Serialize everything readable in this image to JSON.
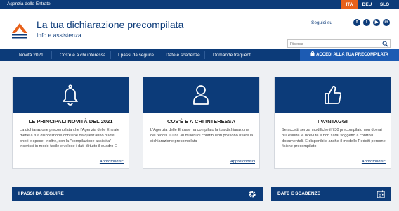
{
  "topbar": {
    "agency": "Agenzia delle Entrate",
    "languages": [
      "ITA",
      "DEU",
      "SLO"
    ],
    "active_language": "ITA"
  },
  "header": {
    "title": "La tua dichiarazione precompilata",
    "subtitle": "Info e assistenza",
    "follow_label": "Seguici su",
    "social": [
      "facebook-icon",
      "twitter-icon",
      "youtube-icon",
      "linkedin-icon"
    ],
    "search_placeholder": "Ricerca"
  },
  "nav": {
    "items": [
      "Novità 2021",
      "Cos'è e a chi interessa",
      "I passi da seguire",
      "Date e scadenze",
      "Domande frequenti"
    ],
    "cta": "ACCEDI ALLA TUA PRECOMPILATA",
    "cta_icon": "lock-icon"
  },
  "cards": [
    {
      "icon": "bell-icon",
      "title": "LE PRINCIPALI NOVITÀ DEL 2021",
      "text": "La dichiarazione precompilata che l'Agenzia delle Entrate mette a tua disposizione contiene da quest'anno nuovi oneri e spese. Inoltre, con la \"compilazione assistita\" inserisci in modo facile e veloce i dati di tutto il quadro E",
      "link": "Approfondisci"
    },
    {
      "icon": "user-icon",
      "title": "COS'È E A CHI INTERESSA",
      "text": "L'Agenzia delle Entrate ha compilato la tua dichiarazione dei redditi. Circa 30 milioni di contribuenti possono usare la dichiarazione precompilata",
      "link": "Approfondisci"
    },
    {
      "icon": "thumbs-up-icon",
      "title": "I VANTAGGI",
      "text": "Se accetti senza modifiche il 730 precompilato non dovrai più esibire le ricevute e non sarai soggetto a controlli documentali. È disponibile anche il modello Redditi persone fisiche precompilato",
      "link": "Approfondisci"
    }
  ],
  "sections": [
    {
      "label": "I PASSI DA SEGUIRE",
      "icon": "gear-icon"
    },
    {
      "label": "DATE E SCADENZE",
      "icon": "calendar-icon"
    }
  ],
  "colors": {
    "primary": "#0c3b79",
    "accent": "#e8611a",
    "cta": "#1c5bb3",
    "background": "#eef0f3"
  }
}
